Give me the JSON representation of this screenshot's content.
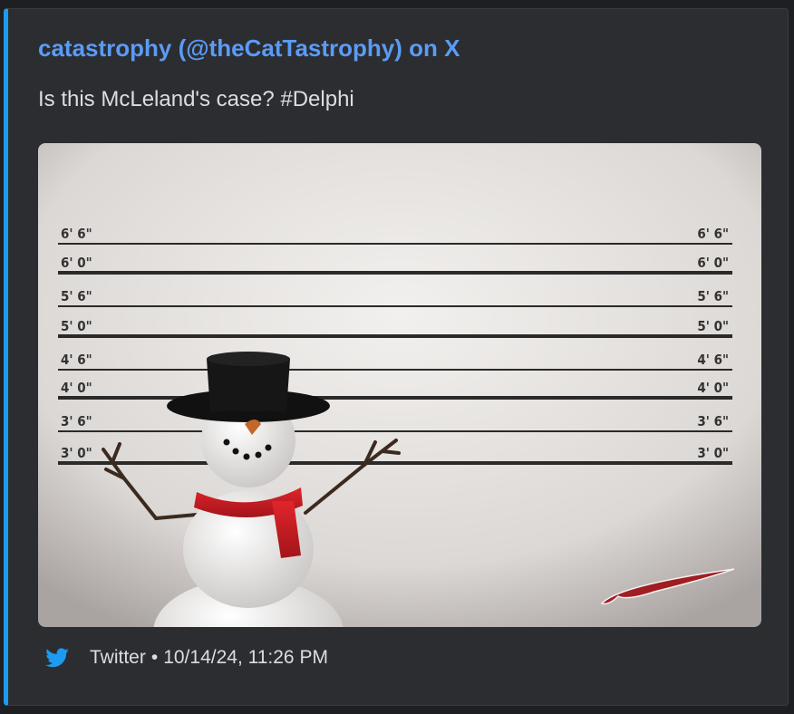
{
  "embed": {
    "accent_color": "#1d9bf0",
    "author": "catastrophy (@theCatTastrophy) on X",
    "description": "Is this McLeland's case? #Delphi",
    "image": {
      "height_labels": [
        "6' 6\"",
        "6' 0\"",
        "5' 6\"",
        "5' 0\"",
        "4' 6\"",
        "4' 0\"",
        "3' 6\"",
        "3' 0\""
      ]
    },
    "footer": {
      "icon": "twitter-bird-icon",
      "provider": "Twitter",
      "separator": "•",
      "timestamp": "10/14/24, 11:26 PM"
    }
  }
}
